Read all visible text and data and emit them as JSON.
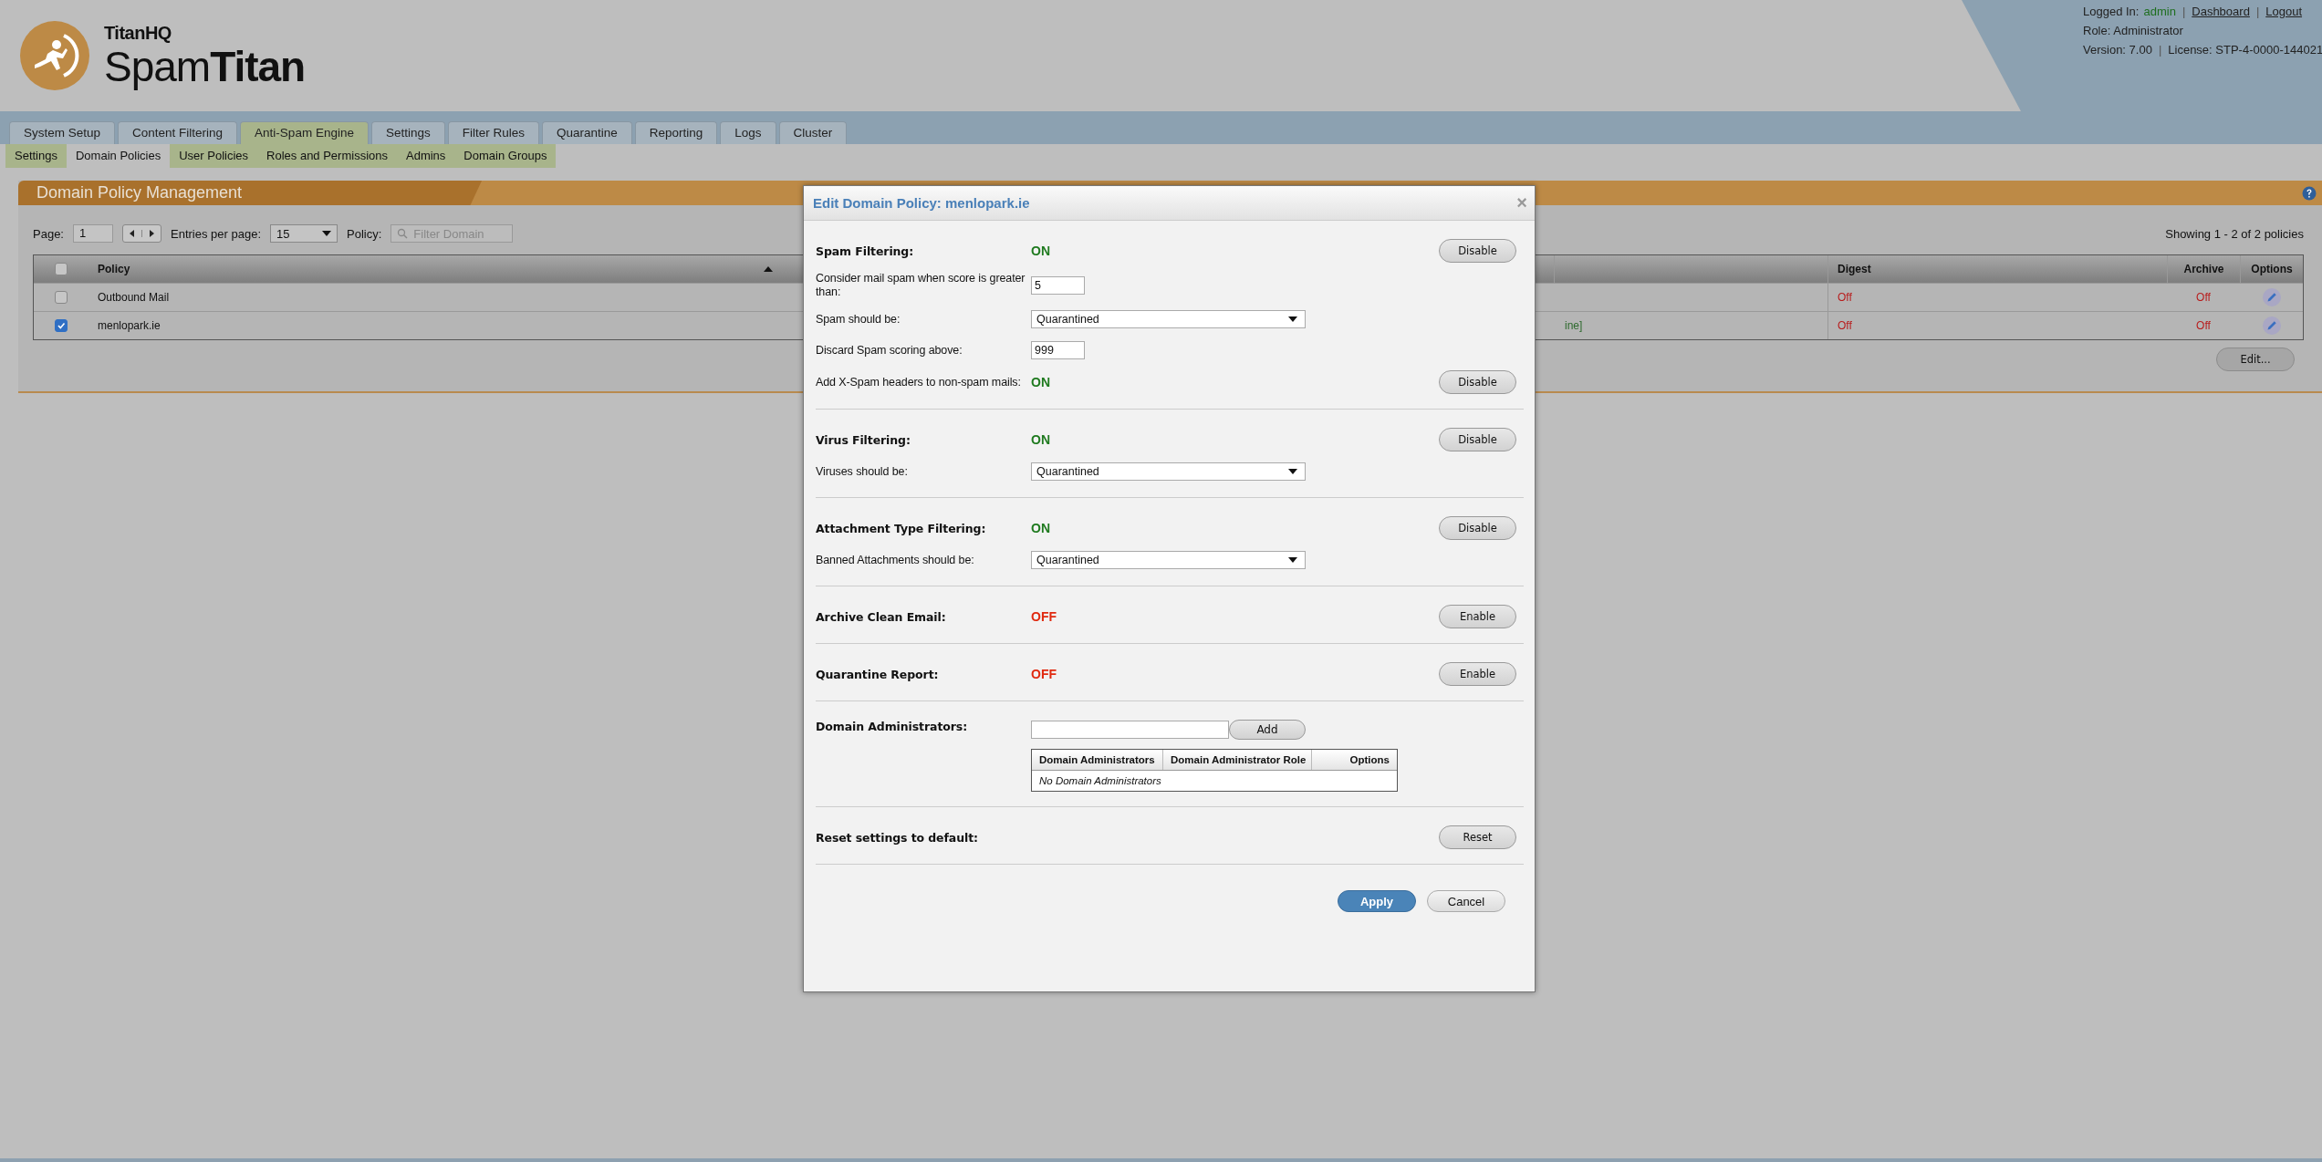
{
  "brand": {
    "company": "TitanHQ",
    "product_light": "Spam",
    "product_bold": "Titan"
  },
  "user_info": {
    "separator": "|",
    "logged_in_label": "Logged In:",
    "user": "admin",
    "links": [
      "Dashboard",
      "Logout"
    ],
    "role": "Role: Administrator",
    "version": "Version: 7.00",
    "license": "License: STP-4-0000-144021"
  },
  "tabs": [
    {
      "label": "System Setup",
      "selected": false
    },
    {
      "label": "Content Filtering",
      "selected": false
    },
    {
      "label": "Anti-Spam Engine",
      "selected": true
    },
    {
      "label": "Settings",
      "selected": false
    },
    {
      "label": "Filter Rules",
      "selected": false
    },
    {
      "label": "Quarantine",
      "selected": false
    },
    {
      "label": "Reporting",
      "selected": false
    },
    {
      "label": "Logs",
      "selected": false
    },
    {
      "label": "Cluster",
      "selected": false
    }
  ],
  "subtabs": [
    {
      "label": "Settings",
      "selected": false
    },
    {
      "label": "Domain Policies",
      "selected": true
    },
    {
      "label": "User Policies",
      "selected": false
    },
    {
      "label": "Roles and Permissions",
      "selected": false
    },
    {
      "label": "Admins",
      "selected": false
    },
    {
      "label": "Domain Groups",
      "selected": false
    }
  ],
  "panel": {
    "title": "Domain Policy Management",
    "page_label": "Page:",
    "page": "1",
    "entries_label": "Entries per page:",
    "entries": "15",
    "policy_label": "Policy:",
    "filter_placeholder": "Filter Domain",
    "showing": "Showing 1 - 2 of 2 policies",
    "select_all_checked": false,
    "columns": [
      "Policy",
      "Digest",
      "Archive",
      "Options"
    ],
    "rows": [
      {
        "checked": false,
        "policy": "Outbound Mail",
        "digest": "Off",
        "archive": "Off"
      },
      {
        "checked": true,
        "policy": "menlopark.ie",
        "column_3": "ine]",
        "digest": "Off",
        "archive": "Off"
      }
    ],
    "edit_button": "Edit..."
  },
  "dialog": {
    "title": "Edit Domain Policy: menlopark.ie",
    "close_label": "×",
    "sections": [
      {
        "title": "Spam Filtering:",
        "status": "ON",
        "on": true,
        "button": "Disable",
        "fields": [
          {
            "kind": "input",
            "label": "Consider mail spam when score is greater than:",
            "value": "5"
          },
          {
            "kind": "select",
            "label": "Spam should be:",
            "value": "Quarantined"
          },
          {
            "kind": "input",
            "label": "Discard Spam scoring above:",
            "value": "999"
          },
          {
            "kind": "toggle",
            "label": "Add X-Spam headers to non-spam mails:",
            "status": "ON",
            "on": true,
            "button": "Disable"
          }
        ]
      },
      {
        "title": "Virus Filtering:",
        "status": "ON",
        "on": true,
        "button": "Disable",
        "fields": [
          {
            "kind": "select",
            "label": "Viruses should be:",
            "value": "Quarantined"
          }
        ]
      },
      {
        "title": "Attachment Type Filtering:",
        "status": "ON",
        "on": true,
        "button": "Disable",
        "fields": [
          {
            "kind": "select",
            "label": "Banned Attachments should be:",
            "value": "Quarantined"
          }
        ]
      },
      {
        "title": "Archive Clean Email:",
        "status": "OFF",
        "on": false,
        "button": "Enable"
      },
      {
        "title": "Quarantine Report:",
        "status": "OFF",
        "on": false,
        "button": "Enable"
      }
    ],
    "admins": {
      "title": "Domain Administrators:",
      "add_button": "Add",
      "columns": [
        "Domain Administrators",
        "Domain Administrator Role",
        "Options"
      ],
      "empty": "No Domain Administrators"
    },
    "reset": {
      "title": "Reset settings to default:",
      "button": "Reset"
    },
    "buttons": [
      {
        "label": "Apply",
        "kind": "primary"
      },
      {
        "label": "Cancel",
        "kind": "default"
      }
    ]
  }
}
